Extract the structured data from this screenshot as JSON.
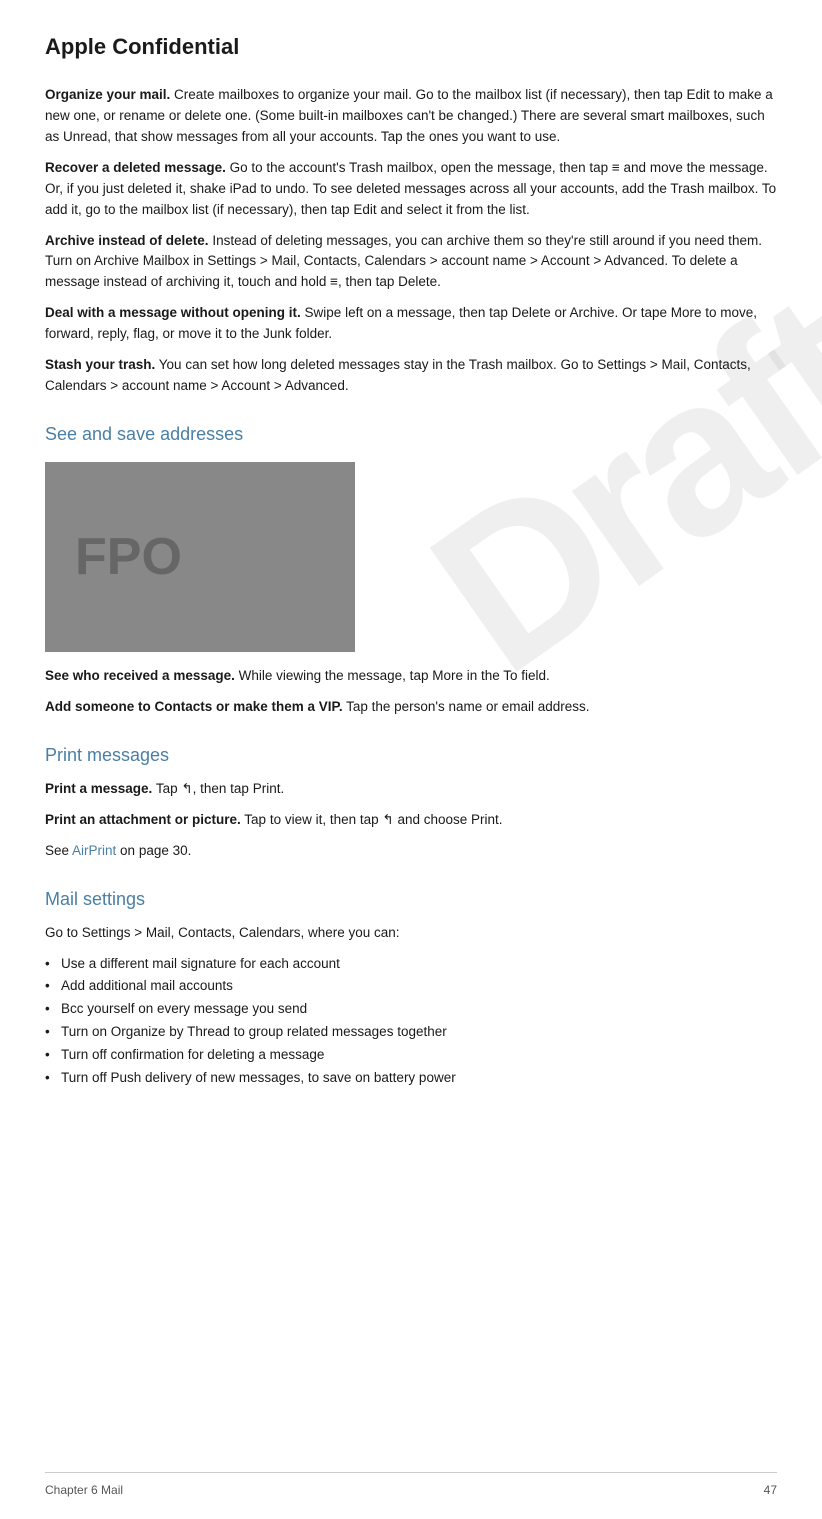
{
  "header": {
    "title": "Apple Confidential"
  },
  "sections": [
    {
      "id": "organize-mail",
      "boldStart": "Organize your mail.",
      "text": " Create mailboxes to organize your mail. Go to the mailbox list (if necessary), then tap Edit to make a new one, or rename or delete one. (Some built-in mailboxes can't be changed.) There are several smart mailboxes, such as Unread, that show messages from all your accounts. Tap the ones you want to use."
    },
    {
      "id": "recover-deleted",
      "boldStart": "Recover a deleted message.",
      "text": " Go to the account's Trash mailbox, open the message, then tap ≡ and move the message. Or, if you just deleted it, shake iPad to undo. To see deleted messages across all your accounts, add the Trash mailbox. To add it, go to the mailbox list (if necessary), then tap Edit and select it from the list."
    },
    {
      "id": "archive-instead",
      "boldStart": "Archive instead of delete.",
      "text": " Instead of deleting messages, you can archive them so they're still around if you need them. Turn on Archive Mailbox in Settings > Mail, Contacts, Calendars > account name > Account > Advanced. To delete a message instead of archiving it, touch and hold ≡, then tap Delete."
    },
    {
      "id": "deal-with-message",
      "boldStart": "Deal with a message without opening it.",
      "text": " Swipe left on a message, then tap Delete or Archive. Or tape More to move, forward, reply, flag, or move it to the Junk folder."
    },
    {
      "id": "stash-trash",
      "boldStart": "Stash your trash.",
      "text": " You can set how long deleted messages stay in the Trash mailbox. Go to Settings > Mail, Contacts, Calendars > account name > Account > Advanced."
    }
  ],
  "see_and_save": {
    "heading": "See and save addresses",
    "fpo_label": "FPO",
    "see_who": {
      "boldStart": "See who received a message.",
      "text": " While viewing the message, tap More in the To field."
    },
    "add_someone": {
      "boldStart": "Add someone to Contacts or make them a VIP.",
      "text": " Tap the person's name or email address."
    }
  },
  "print_messages": {
    "heading": "Print messages",
    "print_message": {
      "boldStart": "Print a message.",
      "text": " Tap ↰, then tap Print."
    },
    "print_attachment": {
      "boldStart": "Print an attachment or picture.",
      "text": " Tap to view it, then tap ↰ and choose Print."
    },
    "see_airprint": "See ",
    "airprint_link": "AirPrint",
    "airprint_suffix": " on page 30."
  },
  "mail_settings": {
    "heading": "Mail settings",
    "intro": "Go to Settings > Mail, Contacts, Calendars, where you can:",
    "bullets": [
      "Use a different mail signature for each account",
      "Add additional mail accounts",
      "Bcc yourself on every message you send",
      "Turn on Organize by Thread to group related messages together",
      "Turn off confirmation for deleting a message",
      "Turn off Push delivery of new messages, to save on battery power"
    ]
  },
  "footer": {
    "chapter": "Chapter  6    Mail",
    "page_number": "47"
  },
  "watermark": {
    "text": "Draft"
  }
}
